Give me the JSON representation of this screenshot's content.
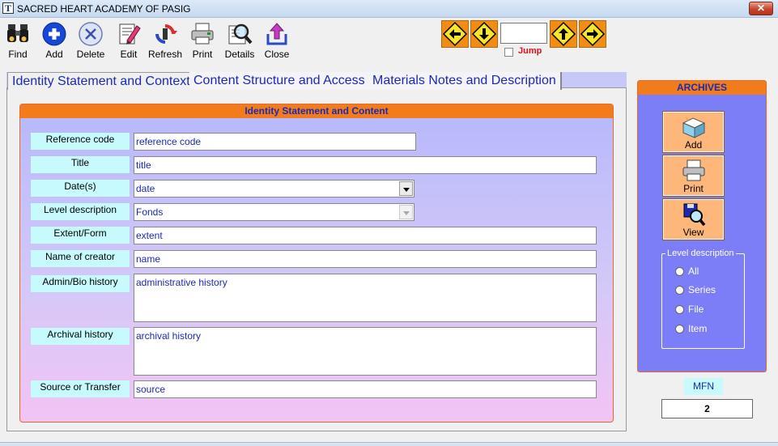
{
  "window": {
    "title": "SACRED HEART ACADEMY OF PASIG",
    "app_icon": "T",
    "close_glyph": "✕"
  },
  "toolbar": {
    "find": "Find",
    "add": "Add",
    "delete": "Delete",
    "edit": "Edit",
    "refresh": "Refresh",
    "print": "Print",
    "details": "Details",
    "close": "Close"
  },
  "navigation": {
    "jump_value": "",
    "jump_label": "Jump",
    "jump_checked": false
  },
  "tabs": [
    {
      "label": "Identity Statement and Context",
      "active": true
    },
    {
      "label": "Content Structure and Access",
      "active": false
    },
    {
      "label": "Materials Notes and Description",
      "active": false
    }
  ],
  "section": {
    "title": "Identity Statement and Content",
    "fields": {
      "reference_code": {
        "label": "Reference code",
        "value": "reference code"
      },
      "title": {
        "label": "Title",
        "value": "title"
      },
      "dates": {
        "label": "Date(s)",
        "value": "date"
      },
      "level_description": {
        "label": "Level description",
        "value": "Fonds"
      },
      "extent_form": {
        "label": "Extent/Form",
        "value": "extent"
      },
      "creator": {
        "label": "Name of creator",
        "value": "name"
      },
      "admin_bio": {
        "label": "Admin/Bio history",
        "value": "administrative history"
      },
      "archival_history": {
        "label": "Archival history",
        "value": "archival history"
      },
      "source": {
        "label": "Source or Transfer",
        "value": "source"
      }
    }
  },
  "archives": {
    "title": "ARCHIVES",
    "add": "Add",
    "print": "Print",
    "view": "View",
    "level_group": {
      "legend": "Level description",
      "options": [
        "All",
        "Series",
        "File",
        "Item"
      ]
    }
  },
  "mfn": {
    "label": "MFN",
    "value": "2"
  },
  "colors": {
    "accent_orange": "#f27b1b",
    "field_label_bg": "#c6fafc",
    "text_blue": "#1a2ab4",
    "panel_purple": "#7b7ef6",
    "jump_red": "#e0101a"
  },
  "icons": {
    "find": "binoculars-icon",
    "add": "plus-circle-icon",
    "delete": "x-circle-icon",
    "edit": "pencil-icon",
    "refresh": "refresh-icon",
    "print": "printer-icon",
    "details": "magnifier-icon",
    "close": "upload-arrow-icon",
    "nav_first": "arrow-left-icon",
    "nav_prev": "arrow-down-icon",
    "nav_next": "arrow-up-icon",
    "nav_last": "arrow-right-icon"
  }
}
